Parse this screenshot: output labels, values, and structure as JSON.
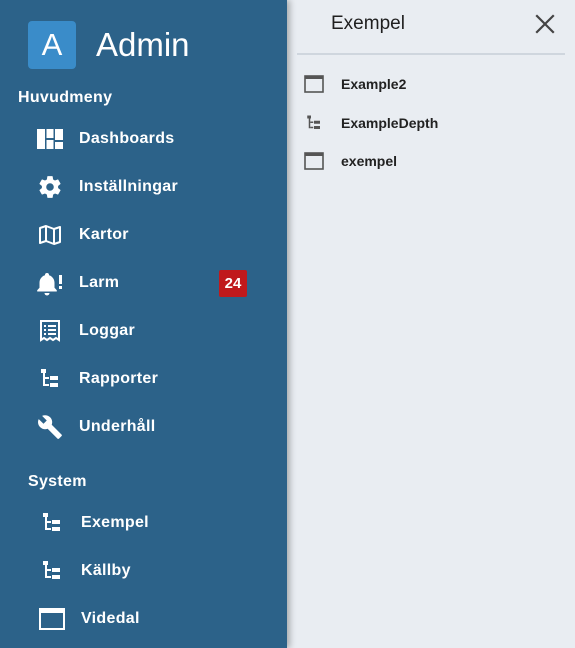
{
  "brand": {
    "letter": "A",
    "title": "Admin"
  },
  "sidebar": {
    "main_section": "Huvudmeny",
    "main_items": [
      {
        "label": "Dashboards",
        "icon": "dashboard-icon"
      },
      {
        "label": "Inställningar",
        "icon": "gear-icon"
      },
      {
        "label": "Kartor",
        "icon": "map-icon"
      },
      {
        "label": "Larm",
        "icon": "bell-alert-icon",
        "badge": "24"
      },
      {
        "label": "Loggar",
        "icon": "receipt-log-icon"
      },
      {
        "label": "Rapporter",
        "icon": "tree-icon"
      },
      {
        "label": "Underhåll",
        "icon": "wrench-icon"
      }
    ],
    "system_section": "System",
    "system_items": [
      {
        "label": "Exempel",
        "icon": "tree-icon"
      },
      {
        "label": "Källby",
        "icon": "tree-icon"
      },
      {
        "label": "Videdal",
        "icon": "window-icon"
      }
    ]
  },
  "panel": {
    "title": "Exempel",
    "items": [
      {
        "label": "Example2",
        "icon": "window-icon"
      },
      {
        "label": "ExampleDepth",
        "icon": "tree-icon"
      },
      {
        "label": "exempel",
        "icon": "window-icon"
      }
    ]
  },
  "colors": {
    "sidebar_bg": "#2c6289",
    "logo_bg": "#3a8cc9",
    "badge_bg": "#c0191c",
    "panel_bg": "#e9edf2"
  }
}
